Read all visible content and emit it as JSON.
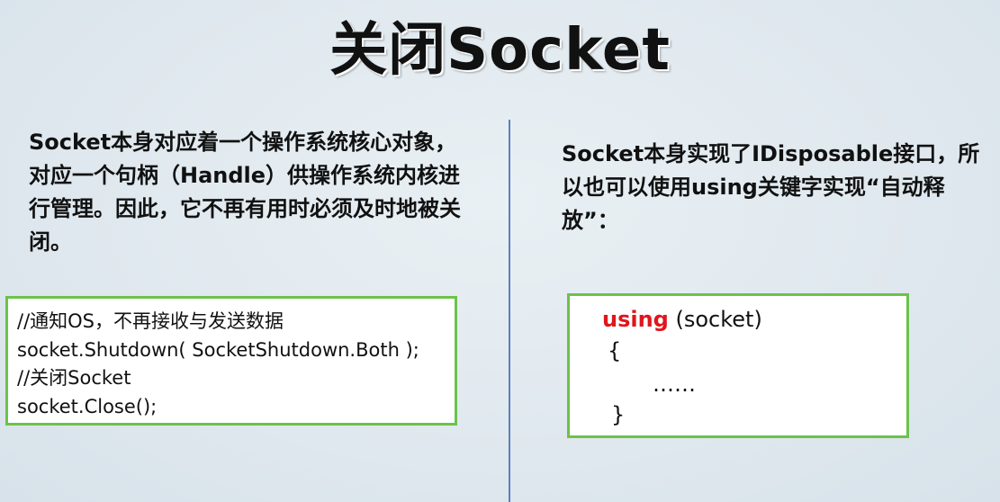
{
  "title": "关闭Socket",
  "left": {
    "paragraph": "Socket本身对应着一个操作系统核心对象，对应一个句柄（Handle）供操作系统内核进行管理。因此，它不再有用时必须及时地被关闭。",
    "code_lines": [
      "//通知OS，不再接收与发送数据",
      "socket.Shutdown( SocketShutdown.Both );",
      "//关闭Socket",
      "socket.Close();"
    ]
  },
  "right": {
    "paragraph": "Socket本身实现了IDisposable接口，所以也可以使用using关键字实现“自动释放”：",
    "code": {
      "keyword": "using",
      "rest": " (socket)",
      "open_brace": "{",
      "body": "……",
      "close_brace": "}"
    }
  },
  "colors": {
    "keyword": "#e0161b",
    "box_border": "#6cc24a",
    "divider": "#5b7fc0"
  }
}
